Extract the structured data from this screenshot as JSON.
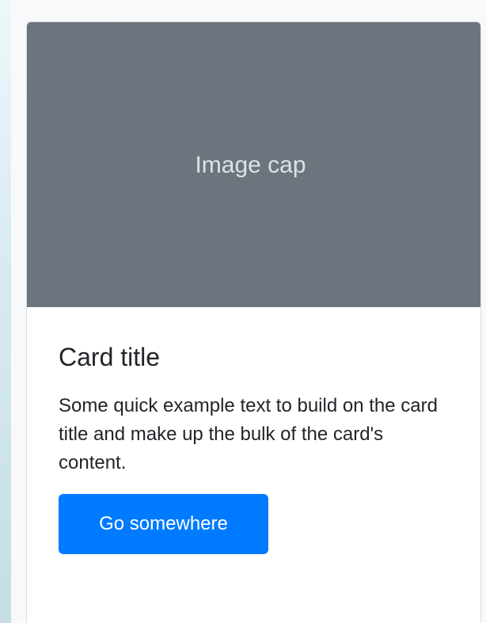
{
  "card": {
    "image_cap": "Image cap",
    "title": "Card title",
    "text": "Some quick example text to build on the card title and make up the bulk of the card's content.",
    "button_label": "Go somewhere"
  },
  "colors": {
    "image_bg": "#6c757d",
    "image_text": "#dee2e6",
    "text": "#212529",
    "button": "#007bff",
    "button_text": "#ffffff",
    "page_bg": "#f8f9fa"
  }
}
